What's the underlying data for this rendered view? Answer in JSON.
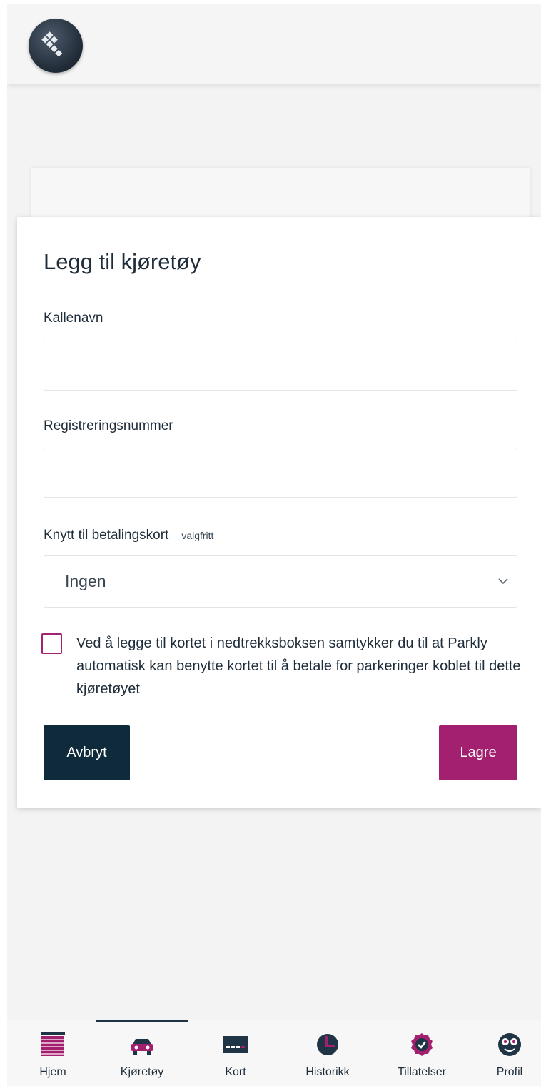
{
  "modal": {
    "title": "Legg til kjøretøy",
    "nickname_label": "Kallenavn",
    "nickname_value": "",
    "regnr_label": "Registreringsnummer",
    "regnr_value": "",
    "card_label": "Knytt til betalingskort",
    "card_optional": "valgfritt",
    "card_selected": "Ingen",
    "consent_checked": false,
    "consent_text": "Ved å legge til kortet i nedtrekksboksen samtykker du til at Parkly automatisk kan benytte kortet til å betale for parkeringer koblet til dette kjøretøyet",
    "cancel_label": "Avbryt",
    "save_label": "Lagre"
  },
  "colors": {
    "accent": "#a2206f",
    "dark": "#0f2a3a",
    "nav_icon_dark": "#1f3444"
  },
  "bottom_nav": {
    "active": "Kjøretøy",
    "items": [
      {
        "label": "Hjem",
        "icon": "home-icon"
      },
      {
        "label": "Kjøretøy",
        "icon": "car-icon"
      },
      {
        "label": "Kort",
        "icon": "card-icon"
      },
      {
        "label": "Historikk",
        "icon": "clock-icon"
      },
      {
        "label": "Tillatelser",
        "icon": "badge-check-icon"
      },
      {
        "label": "Profil",
        "icon": "profile-face-icon"
      }
    ]
  }
}
